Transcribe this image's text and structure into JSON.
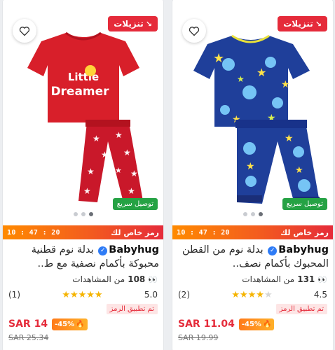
{
  "products": [
    {
      "sale_badge": "تنزيلات",
      "fast_delivery": "توصيل سريع",
      "promo_label": "رمز خاص لك",
      "timer": "10 : 47 : 20",
      "brand": "Babyhug",
      "title": "بدلة نوم قطنية محبوكة بأكمام نصفية مع ط..",
      "views_count": "108",
      "views_label": "من المشاهدات",
      "rating": "5.0",
      "reviews": "(1)",
      "coupon_applied": "تم تطبيق الرمز",
      "price": "SAR 14",
      "discount": "-45%",
      "old_price": "SAR 25.34",
      "colors": {
        "shirt": "#d81f2a",
        "pants": "#c9182a"
      }
    },
    {
      "sale_badge": "تنزيلات",
      "fast_delivery": "توصيل سريع",
      "promo_label": "رمز خاص لك",
      "timer": "10 : 47 : 20",
      "brand": "Babyhug",
      "title": "بدلة نوم من القطن المحبوك بأكمام نصف..",
      "views_count": "131",
      "views_label": "من المشاهدات",
      "rating": "4.5",
      "reviews": "(2)",
      "coupon_applied": "تم تطبيق الرمز",
      "price": "SAR 11.04",
      "discount": "-45%",
      "old_price": "SAR 19.99",
      "colors": {
        "shirt": "#1f3f9a",
        "pants": "#1f3f9a"
      }
    }
  ],
  "shirt_text": {
    "line1": "Little",
    "line2": "Dreamer"
  },
  "icons": {
    "wishlist": "heart-icon",
    "sale": "arrow-down-icon",
    "verified": "check-badge-icon",
    "views": "eyes-icon",
    "discount": "flame-icon"
  }
}
